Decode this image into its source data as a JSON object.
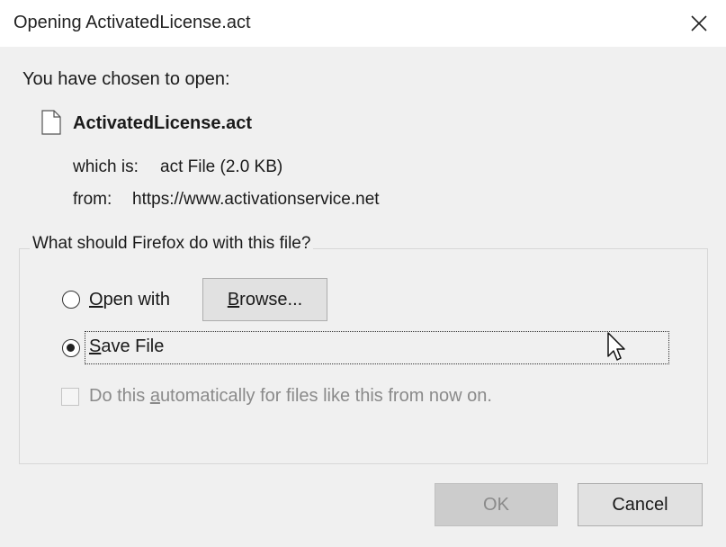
{
  "window": {
    "title": "Opening ActivatedLicense.act"
  },
  "dialog": {
    "intro": "You have chosen to open:",
    "filename": "ActivatedLicense.act",
    "which_is_label": "which is:",
    "which_is_value": "act File (2.0 KB)",
    "from_label": "from:",
    "from_value": "https://www.activationservice.net"
  },
  "options": {
    "legend": "What should Firefox do with this file?",
    "open_with_accel": "O",
    "open_with_rest": "pen with",
    "browse_accel": "B",
    "browse_rest": "rowse...",
    "save_file_accel": "S",
    "save_file_rest": "ave File",
    "auto_pre": "Do this ",
    "auto_accel": "a",
    "auto_rest": "utomatically for files like this from now on.",
    "selected": "save_file",
    "auto_checked": false
  },
  "buttons": {
    "ok": "OK",
    "cancel": "Cancel"
  }
}
